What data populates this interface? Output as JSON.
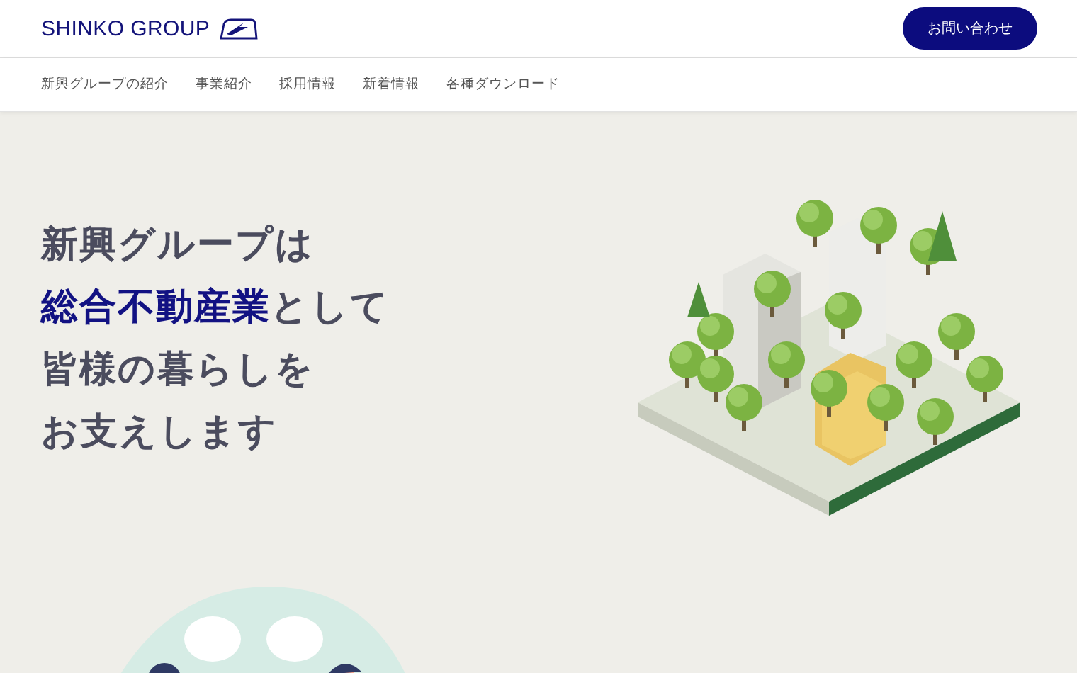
{
  "header": {
    "logo": "SHINKO GROUP",
    "contact_button": "お問い合わせ"
  },
  "nav": {
    "items": [
      {
        "label": "新興グループの紹介"
      },
      {
        "label": "事業紹介"
      },
      {
        "label": "採用情報"
      },
      {
        "label": "新着情報"
      },
      {
        "label": "各種ダウンロード"
      }
    ]
  },
  "hero": {
    "headline": [
      [
        {
          "text": "新興グループは",
          "accent": false
        }
      ],
      [
        {
          "text": "総合不動産業",
          "accent": true
        },
        {
          "text": "として",
          "accent": false
        }
      ],
      [
        {
          "text": "皆様の暮らしを",
          "accent": false
        }
      ],
      [
        {
          "text": "お支えします",
          "accent": false
        }
      ]
    ]
  }
}
